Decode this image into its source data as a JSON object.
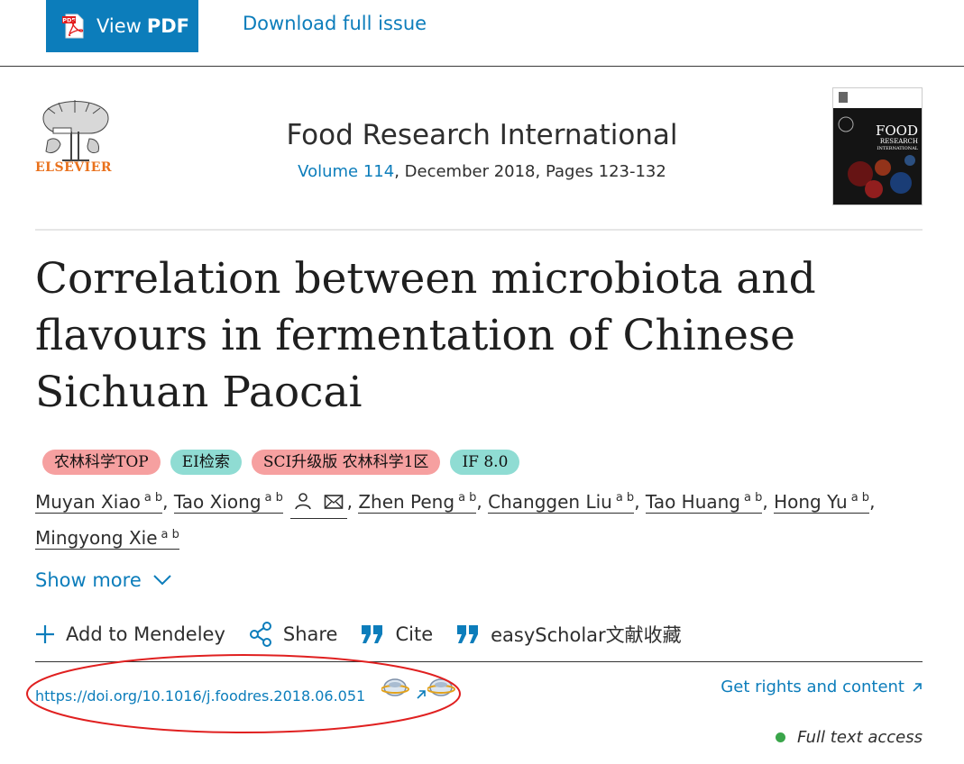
{
  "topbar": {
    "view_pdf_prefix": "View",
    "view_pdf_bold": "PDF",
    "download_label": "Download full issue",
    "pdf_icon_text": "PDF"
  },
  "journal": {
    "publisher_logo_text": "ELSEVIER",
    "title": "Food Research International",
    "volume_link": "Volume 114",
    "meta_rest": ", December 2018, Pages 123-132",
    "cover_title": "FOOD",
    "cover_subtitle_1": "RESEARCH",
    "cover_subtitle_2": "INTERNATIONAL"
  },
  "article": {
    "title": "Correlation between microbiota and flavours in fermentation of Chinese Sichuan Paocai"
  },
  "badges": [
    {
      "label": "农林科学TOP",
      "color": "#f6a0a0"
    },
    {
      "label": "EI检索",
      "color": "#8fdcd3"
    },
    {
      "label": "SCI升级版 农林科学1区",
      "color": "#f6a0a0"
    },
    {
      "label": "IF 8.0",
      "color": "#8fdcd3"
    }
  ],
  "authors": [
    {
      "name": "Muyan Xiao",
      "aff": "a b"
    },
    {
      "name": "Tao Xiong",
      "aff": "a b"
    },
    {
      "name": "Zhen Peng",
      "aff": "a b"
    },
    {
      "name": "Changgen Liu",
      "aff": "a b"
    },
    {
      "name": "Tao Huang",
      "aff": "a b"
    },
    {
      "name": "Hong Yu",
      "aff": "a b"
    },
    {
      "name": "Mingyong Xie",
      "aff": "a b"
    }
  ],
  "author_separator": ",",
  "show_more": "Show more",
  "actions": {
    "mendeley": "Add to Mendeley",
    "share": "Share",
    "cite": "Cite",
    "easyscholar": "easyScholar文献收藏"
  },
  "doi": {
    "link": "https://doi.org/10.1016/j.foodres.2018.06.051"
  },
  "rights": "Get rights and content",
  "access": "Full text access",
  "colors": {
    "accent": "#0c7dbb",
    "elsevier_orange": "#e9711c",
    "access_green": "#3aa54a",
    "annotation_red": "#e02020"
  }
}
